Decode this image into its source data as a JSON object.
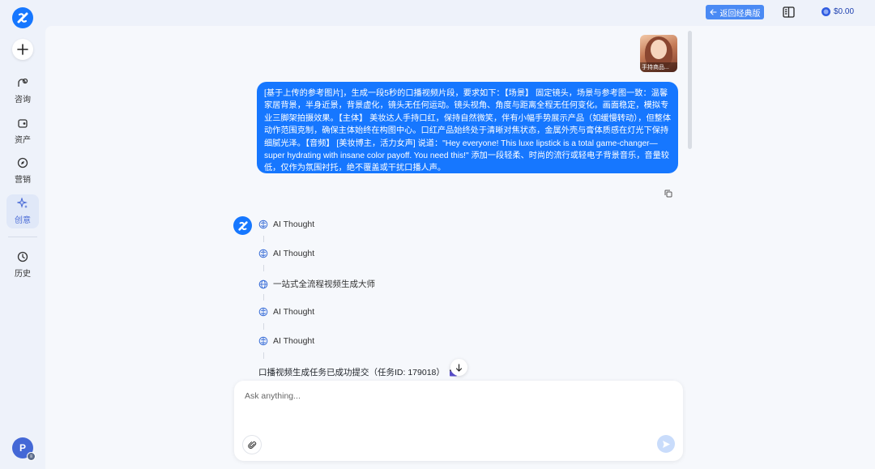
{
  "sidebar": {
    "items": [
      {
        "label": "咨询",
        "icon": "consult-icon"
      },
      {
        "label": "资产",
        "icon": "asset-icon"
      },
      {
        "label": "营销",
        "icon": "compass-icon"
      },
      {
        "label": "创意",
        "icon": "sparkle-icon"
      },
      {
        "label": "历史",
        "icon": "clock-icon"
      }
    ],
    "active": "创意",
    "avatar_initial": "P"
  },
  "topbar": {
    "back_label": "返回经典版",
    "credits": "$0.00"
  },
  "colors": {
    "accent": "#1677ff",
    "background": "#eef2fa",
    "panel": "#f6f8fc"
  },
  "chat": {
    "reference_image_caption": "手持商品...",
    "user_message": "[基于上传的参考图片]，生成一段5秒的口播视频片段，要求如下：【场景】 固定镜头，场景与参考图一致：温馨家居背景，半身近景，背景虚化，镜头无任何运动。镜头视角、角度与距离全程无任何变化。画面稳定，模拟专业三脚架拍摄效果。【主体】 美妆达人手持口红，保持自然微笑，伴有小幅手势展示产品（如缓慢转动），但整体动作范围克制，确保主体始终在构图中心。口红产品始终处于清晰对焦状态，金属外壳与膏体质感在灯光下保持细腻光泽。【音频】 [美妆博主，活力女声] 说道：\"Hey everyone! This luxe lipstick is a total game-changer—super hydrating with insane color payoff. You need this!\" 添加一段轻柔、时尚的流行或轻电子背景音乐，音量较低，仅作为氛围衬托，绝不覆盖或干扰口播人声。",
    "steps": [
      {
        "label": "AI Thought",
        "icon": "brain-icon"
      },
      {
        "label": "AI Thought",
        "icon": "brain-icon"
      },
      {
        "label": "一站式全流程视频生成大师",
        "icon": "globe-icon"
      },
      {
        "label": "AI Thought",
        "icon": "brain-icon"
      },
      {
        "label": "AI Thought",
        "icon": "brain-icon"
      }
    ],
    "final_message": "口播视频生成任务已成功提交（任务ID: 179018）"
  },
  "composer": {
    "placeholder": "Ask anything..."
  }
}
